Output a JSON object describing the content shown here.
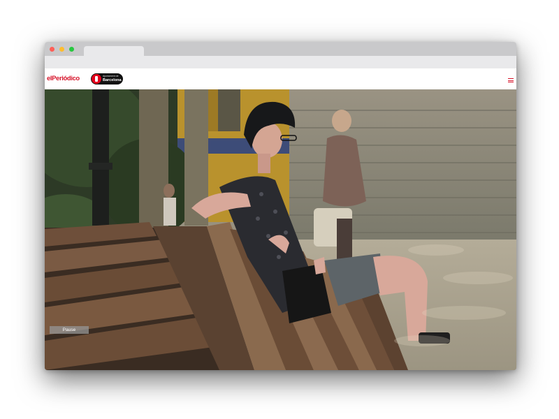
{
  "browser": {
    "window_controls": [
      "close",
      "minimize",
      "maximize"
    ]
  },
  "header": {
    "logo_text": "elPeriódico",
    "partner_logo": {
      "line1": "Ajuntament de",
      "line2": "Barcelona"
    },
    "menu_icon": "hamburger-menu-icon"
  },
  "video": {
    "pause_label": "Pause"
  },
  "colors": {
    "brand_red": "#d7152b",
    "titlebar": "#c9c9cb",
    "partner_badge": "#111111"
  }
}
